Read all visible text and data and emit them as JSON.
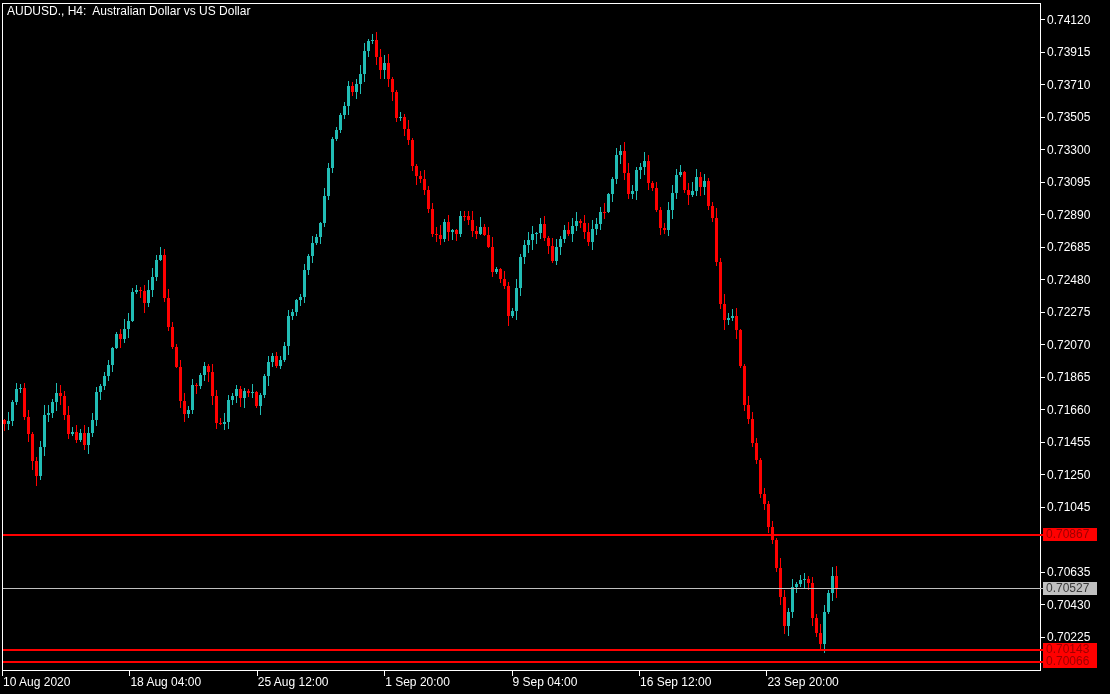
{
  "chart": {
    "title": "AUDUSD., H4:  Australian Dollar vs US Dollar",
    "price_scale": [
      "0.74120",
      "0.73915",
      "0.73710",
      "0.73505",
      "0.73300",
      "0.73095",
      "0.72890",
      "0.72685",
      "0.72480",
      "0.72275",
      "0.72070",
      "0.71865",
      "0.71660",
      "0.71455",
      "0.71250",
      "0.71045",
      "0.70635",
      "0.70430",
      "0.70225"
    ],
    "time_scale": [
      "10 Aug 2020",
      "18 Aug 04:00",
      "25 Aug 12:00",
      "1 Sep 20:00",
      "9 Sep 04:00",
      "16 Sep 12:00",
      "23 Sep 20:00"
    ],
    "price_lines": [
      {
        "kind": "level",
        "color": "#ff0000",
        "label": "0.70867"
      },
      {
        "kind": "bid",
        "color": "#c0c0c0",
        "label": "0.70527"
      },
      {
        "kind": "level",
        "color": "#ff0000",
        "label": "0.70143"
      },
      {
        "kind": "level",
        "color": "#ff0000",
        "label": "0.70066"
      }
    ]
  }
}
